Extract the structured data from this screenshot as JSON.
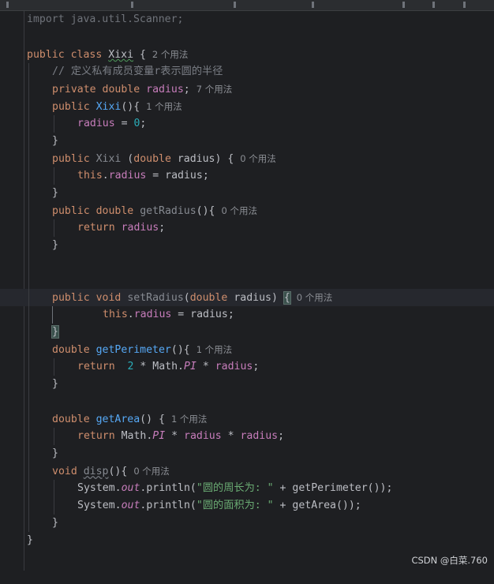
{
  "editor": {
    "import_kw": "import",
    "import_path": " java.util.Scanner;",
    "class_line": {
      "kw1": "public",
      "kw2": "class",
      "name": "Xixi",
      "brace": " {",
      "hint": "2 个用法"
    },
    "comment": "// 定义私有成员变量r表示圆的半径",
    "field_line": {
      "kw1": "private",
      "kw2": "double",
      "name": "radius",
      "semi": ";",
      "hint": "7 个用法"
    },
    "ctor1_line": {
      "kw": "public",
      "name": "Xixi",
      "rest": "(){",
      "hint": "1 个用法"
    },
    "ctor1_body": {
      "field": "radius",
      "op": " = ",
      "num": "0",
      "semi": ";"
    },
    "close": "}",
    "ctor2_line": {
      "kw": "public",
      "name": "Xixi",
      "p1": " (",
      "type": "double",
      "param": " radius) {",
      "hint": "0 个用法"
    },
    "ctor2_body": {
      "this": "this",
      "dot": ".",
      "field": "radius",
      "rest": " = radius;"
    },
    "getr_line": {
      "kw1": "public",
      "kw2": "double",
      "name": "getRadius",
      "rest": "(){",
      "hint": "0 个用法"
    },
    "getr_body": {
      "kw": "return",
      "field": "radius",
      "semi": ";"
    },
    "setr_line": {
      "kw1": "public",
      "kw2": "void",
      "name": "setRadius",
      "p1": "(",
      "type": "double",
      "param": " radius) ",
      "brace": "{",
      "hint": "0 个用法"
    },
    "setr_body": {
      "this": "this",
      "dot": ".",
      "field": "radius",
      "rest": " = radius;"
    },
    "setr_close": "}",
    "perim_line": {
      "kw": "double",
      "name": "getPerimeter",
      "rest": "(){",
      "hint": "1 个用法"
    },
    "perim_body": {
      "kw": "return",
      "num": "2",
      "mid": " * Math.",
      "pi": "PI",
      "op": " * ",
      "field": "radius",
      "semi": ";"
    },
    "area_line": {
      "kw": "double",
      "name": "getArea",
      "rest": "() {",
      "hint": "1 个用法"
    },
    "area_body": {
      "kw": "return",
      "mid": " Math.",
      "pi": "PI",
      "op1": " * ",
      "f1": "radius",
      "op2": " * ",
      "f2": "radius",
      "semi": ";"
    },
    "disp_line": {
      "kw": "void",
      "name": "disp",
      "rest": "(){",
      "hint": "0 个用法"
    },
    "print1": {
      "sys": "System.",
      "out": "out",
      "call": ".println(",
      "str": "\"圆的周长为: \"",
      "rest": " + getPerimeter());"
    },
    "print2": {
      "sys": "System.",
      "out": "out",
      "call": ".println(",
      "str": "\"圆的面积为: \"",
      "rest": " + getArea());"
    }
  },
  "watermark": "CSDN @白菜.760"
}
